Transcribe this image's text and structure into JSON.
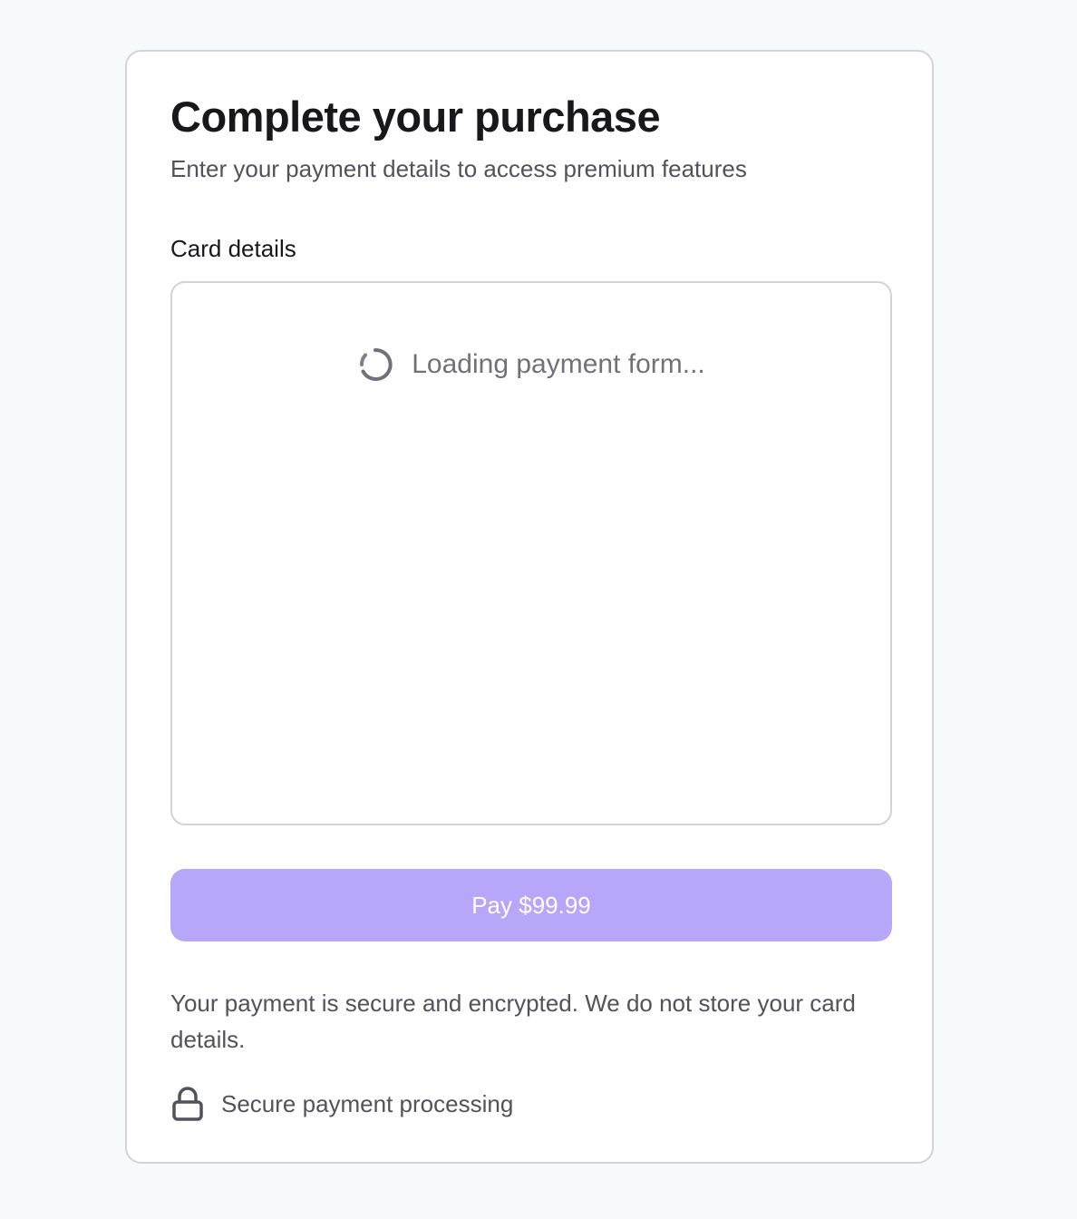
{
  "header": {
    "title": "Complete your purchase",
    "subtitle": "Enter your payment details to access premium features"
  },
  "form": {
    "card_label": "Card details",
    "loading_text": "Loading payment form...",
    "loading_icon": "spinner-icon"
  },
  "pay_button": {
    "label": "Pay $99.99",
    "state": "disabled"
  },
  "footer": {
    "security_note": "Your payment is secure and encrypted. We do not store your card details.",
    "secure_label": "Secure payment processing",
    "secure_icon": "lock-icon"
  },
  "colors": {
    "accent": "#b8a6f8",
    "background": "#f8f9fb",
    "card": "#ffffff",
    "border": "#d4d4d8",
    "heading": "#18181b",
    "muted_text": "#52525b",
    "spinner": "#71717a"
  }
}
